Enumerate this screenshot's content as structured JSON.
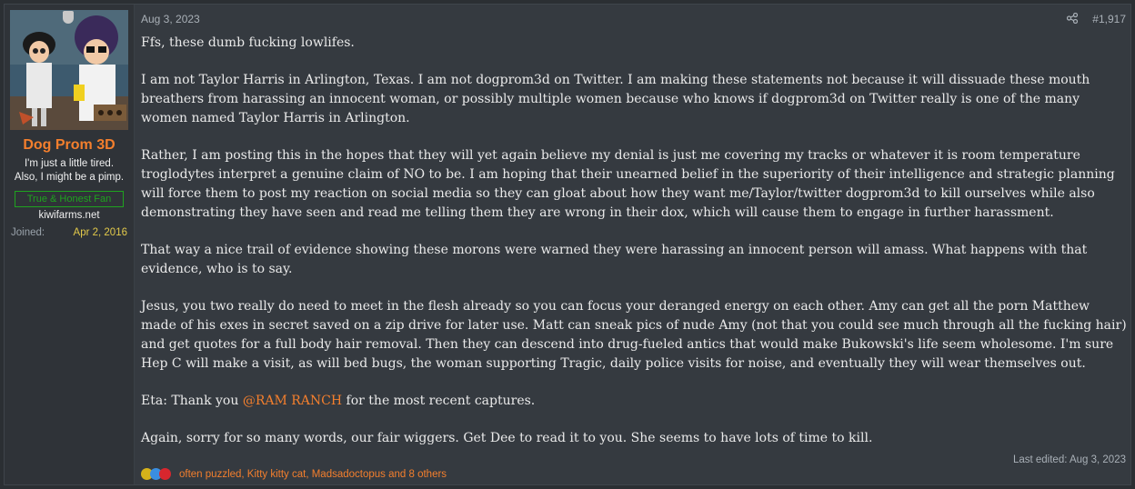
{
  "user": {
    "name": "Dog Prom 3D",
    "title_line1": "I'm just a little tired.",
    "title_line2": "Also, I might be a pimp.",
    "banner": "True & Honest Fan",
    "website": "kiwifarms.net",
    "joined_label": "Joined:",
    "joined_value": "Apr 2, 2016"
  },
  "post": {
    "date": "Aug 3, 2023",
    "number": "#1,917",
    "p1": "Ffs, these dumb fucking lowlifes.",
    "p2": "I am not Taylor Harris in Arlington, Texas. I am not dogprom3d on Twitter. I am making these statements not because it will dissuade these mouth breathers from harassing an innocent woman, or possibly multiple women because who knows if dogprom3d on Twitter really is one of the many women named Taylor Harris in Arlington.",
    "p3": "Rather, I am posting this in the hopes that they will yet again believe my denial is just me covering my tracks or whatever it is room temperature troglodytes interpret a genuine claim of NO to be. I am hoping that their unearned belief in the superiority of their intelligence and strategic planning will force them to post my reaction on social media so they can gloat about how they want me/Taylor/twitter dogprom3d to kill ourselves while also demonstrating they have seen and read me telling them they are wrong in their dox, which will cause them to engage in further harassment.",
    "p4": "That way a nice trail of evidence showing these morons were warned they were harassing an innocent person will amass. What happens with that evidence, who is to say.",
    "p5": "Jesus, you two really do need to meet in the flesh already so you can focus your deranged energy on each other. Amy can get all the porn Matthew made of his exes in secret saved on a zip drive for later use. Matt can sneak pics of nude Amy (not that you could see much through all the fucking hair) and get quotes for a full body hair removal. Then they can descend into drug-fueled antics that would make Bukowski's life seem wholesome. I'm sure Hep C will make a visit, as will bed bugs, the woman supporting Tragic, daily police visits for noise, and eventually they will wear themselves out.",
    "p6_pre": "Eta: Thank you ",
    "p6_mention": "@RAM RANCH",
    "p6_post": " for the most recent captures.",
    "p7": "Again, sorry for so many words, our fair wiggers. Get Dee to read it to you. She seems to have lots of time to kill.",
    "last_edited": "Last edited: Aug 3, 2023",
    "reactions_text": "often puzzled, Kitty kitty cat, Madsadoctopus and 8 others"
  },
  "icons": {
    "share": "share-icon",
    "reactions": [
      "pineapple-icon",
      "thumbs-up-icon",
      "heart-icon"
    ]
  },
  "colors": {
    "accent": "#f47f2d",
    "banner": "#1fa31f",
    "joined": "#e2c94a"
  }
}
